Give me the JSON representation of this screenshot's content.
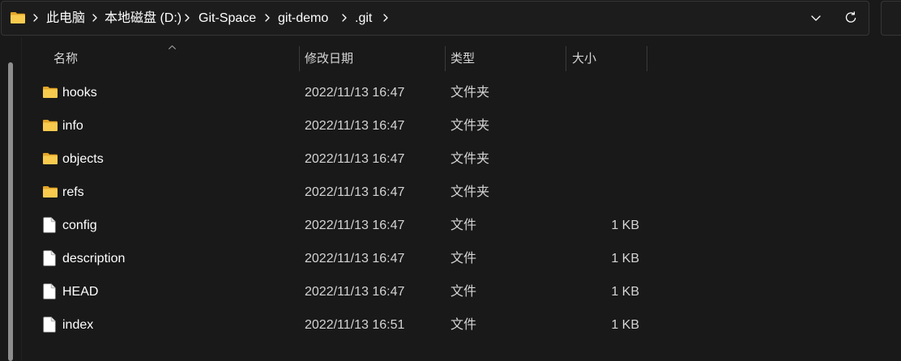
{
  "theme": {
    "background": "#191919",
    "text_primary": "#ffffff",
    "text_secondary": "#d4d4d4",
    "folder_front": "#f8cb4f",
    "folder_back": "#e3a527"
  },
  "address_bar": {
    "location_icon": "folder-icon",
    "separator_icon": "chevron-right-icon",
    "breadcrumbs": [
      {
        "label": "此电脑"
      },
      {
        "label": "本地磁盘 (D:)"
      },
      {
        "label": "Git-Space"
      },
      {
        "label": "git-demo"
      },
      {
        "label": ".git"
      }
    ],
    "history_dropdown_icon": "chevron-down-icon",
    "refresh_icon": "refresh-icon"
  },
  "file_list": {
    "sort_icon": "chevron-up-icon",
    "columns": [
      {
        "label": "名称"
      },
      {
        "label": "修改日期"
      },
      {
        "label": "类型"
      },
      {
        "label": "大小"
      }
    ],
    "items": [
      {
        "name": "hooks",
        "modified": "2022/11/13 16:47",
        "type": "文件夹",
        "icon": "folder-icon"
      },
      {
        "name": "info",
        "modified": "2022/11/13 16:47",
        "type": "文件夹",
        "icon": "folder-icon"
      },
      {
        "name": "objects",
        "modified": "2022/11/13 16:47",
        "type": "文件夹",
        "icon": "folder-icon"
      },
      {
        "name": "refs",
        "modified": "2022/11/13 16:47",
        "type": "文件夹",
        "icon": "folder-icon"
      },
      {
        "name": "config",
        "modified": "2022/11/13 16:47",
        "type": "文件",
        "size": "1 KB",
        "icon": "file-icon"
      },
      {
        "name": "description",
        "modified": "2022/11/13 16:47",
        "type": "文件",
        "size": "1 KB",
        "icon": "file-icon"
      },
      {
        "name": "HEAD",
        "modified": "2022/11/13 16:47",
        "type": "文件",
        "size": "1 KB",
        "icon": "file-icon"
      },
      {
        "name": "index",
        "modified": "2022/11/13 16:51",
        "type": "文件",
        "size": "1 KB",
        "icon": "file-icon"
      }
    ]
  }
}
